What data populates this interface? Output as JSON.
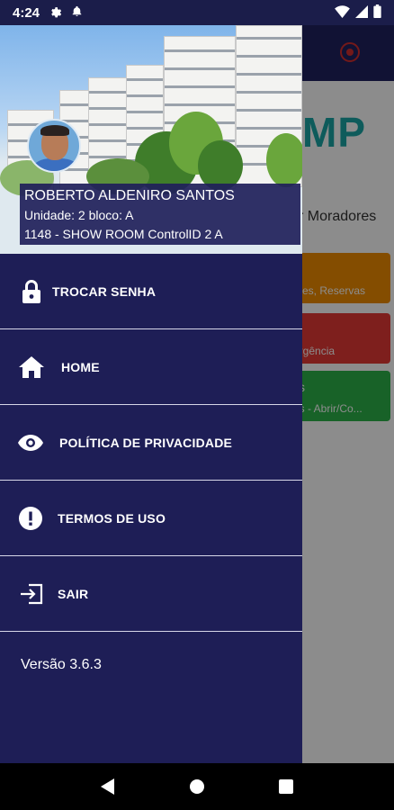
{
  "status_bar": {
    "time": "4:24"
  },
  "background_app": {
    "logo_text": "MP",
    "moradores_text": "r Moradores",
    "cards": [
      {
        "text": "ntes, Reservas",
        "color": "#f08c00"
      },
      {
        "text": "ergência",
        "color": "#e53935"
      },
      {
        "text": "as - Abrir/Co...",
        "color": "#2db34a",
        "small": "s"
      }
    ]
  },
  "drawer": {
    "user": {
      "name": "ROBERTO ALDENIRO SANTOS",
      "unit": "Unidade: 2 bloco: A",
      "location": "1148 - SHOW ROOM ControlID 2 A"
    },
    "menu": [
      {
        "label": "TROCAR SENHA",
        "icon": "lock-icon"
      },
      {
        "label": "HOME",
        "icon": "home-icon"
      },
      {
        "label": "POLÍTICA DE PRIVACIDADE",
        "icon": "eye-icon"
      },
      {
        "label": "TERMOS DE USO",
        "icon": "alert-icon"
      },
      {
        "label": "SAIR",
        "icon": "logout-icon"
      }
    ],
    "version": "Versão 3.6.3"
  },
  "colors": {
    "drawer_bg": "#1e1e56",
    "toolbar_bg": "#1f2260",
    "accent_teal": "#1aa6a6"
  }
}
